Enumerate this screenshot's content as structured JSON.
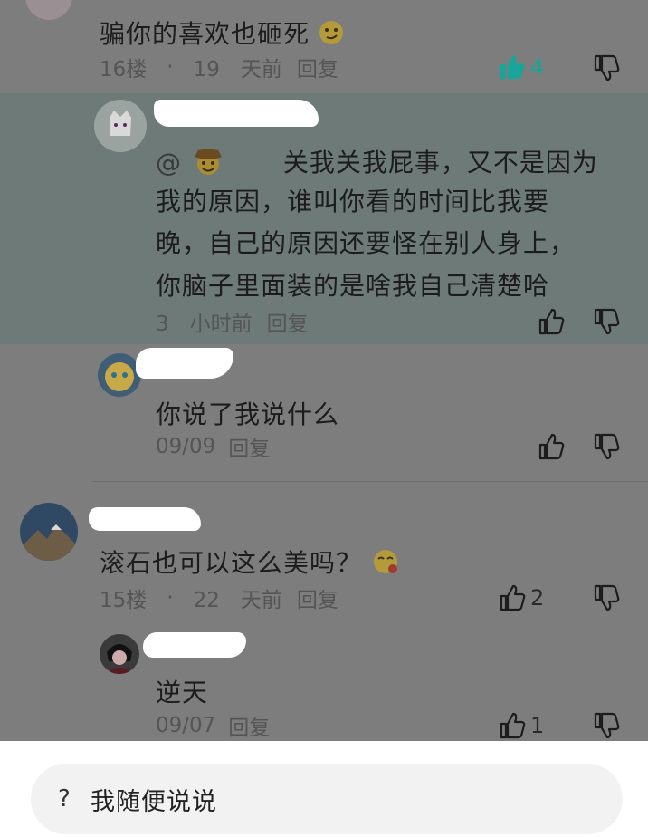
{
  "colors": {
    "overlay": "#7d7d7d",
    "highlight": "#6d7a77",
    "like_active": "#1aa59a",
    "text": "#1c1c1c",
    "meta": "#555555"
  },
  "comments": [
    {
      "text": "骗你的喜欢也砸死",
      "emoji": "smirk-emoji",
      "floor": "16楼",
      "dot": "·",
      "time": "19　天前",
      "reply_label": "回复",
      "likes": "4",
      "liked": true
    },
    {
      "mention": "@",
      "text_lines": [
        "关我关我屁事，又不是因为",
        "我的原因，谁叫你看的时间比我要",
        "晚，自己的原因还要怪在别人身上，",
        "你脑子里面装的是啥我自己清楚哈"
      ],
      "time": "3　小时前",
      "reply_label": "回复",
      "likes": ""
    },
    {
      "text": "你说了我说什么",
      "time": "09/09",
      "reply_label": "回复",
      "likes": ""
    },
    {
      "text": "滚石也可以这么美吗？",
      "emoji": "flower-face-emoji",
      "floor": "15楼",
      "dot": "·",
      "time": "22　天前",
      "reply_label": "回复",
      "likes": "2"
    },
    {
      "text": "逆天",
      "time": "09/07",
      "reply_label": "回复",
      "likes": "1"
    }
  ],
  "input": {
    "icon": "?",
    "placeholder": "我随便说说"
  }
}
